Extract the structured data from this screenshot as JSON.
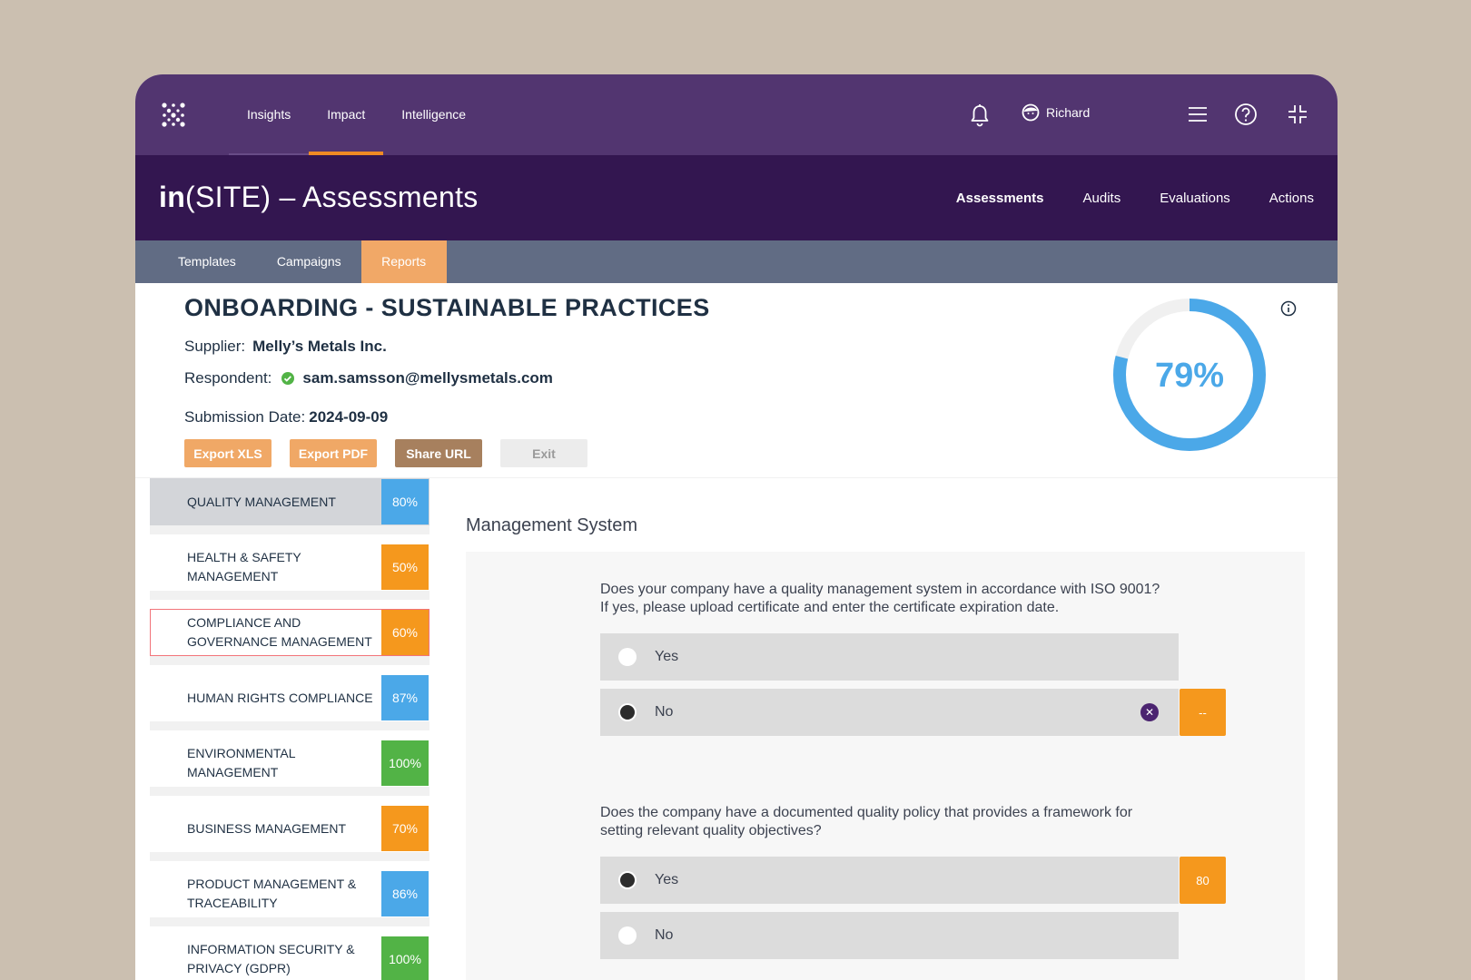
{
  "colors": {
    "top_nav": "#523570",
    "app_header": "#331650",
    "sub_tabs": "#616c84",
    "accent_orange": "#f08a24",
    "blue": "#4ba8e8",
    "orange": "#f5981d",
    "green": "#52b346"
  },
  "global_nav": {
    "links": [
      "Insights",
      "Impact",
      "Intelligence"
    ],
    "active": "Impact",
    "user_name": "Richard",
    "icons": [
      "logo-icon",
      "bell-icon",
      "user-avatar-icon",
      "hamburger-menu-icon",
      "help-icon",
      "collapse-icon"
    ]
  },
  "app": {
    "title_bold": "in",
    "title_rest": "(SITE) – Assessments",
    "nav": [
      "Assessments",
      "Audits",
      "Evaluations",
      "Actions"
    ],
    "active_nav": "Assessments"
  },
  "sub_tabs": [
    "Templates",
    "Campaigns",
    "Reports"
  ],
  "active_sub_tab": "Reports",
  "report": {
    "title": "ONBOARDING - SUSTAINABLE PRACTICES",
    "supplier_label": "Supplier:",
    "supplier": "Melly’s Metals Inc.",
    "respondent_label": "Respondent:",
    "respondent": "sam.samsson@mellysmetals.com",
    "submission_label": "Submission Date:",
    "submission_date": "2024-09-09",
    "buttons": [
      "Export XLS",
      "Export PDF",
      "Share URL",
      "Exit"
    ],
    "overall_score": "79%",
    "overall_fraction": 0.79
  },
  "categories": [
    {
      "label": "QUALITY MANAGEMENT",
      "pct": "80%",
      "color": "#4ba8e8",
      "selected": true
    },
    {
      "label": "HEALTH & SAFETY MANAGEMENT",
      "pct": "50%",
      "color": "#f5981d"
    },
    {
      "label": "COMPLIANCE AND GOVERNANCE MANAGEMENT",
      "pct": "60%",
      "color": "#f5981d",
      "outlined": true
    },
    {
      "label": "HUMAN RIGHTS COMPLIANCE",
      "pct": "87%",
      "color": "#4ba8e8"
    },
    {
      "label": "ENVIRONMENTAL MANAGEMENT",
      "pct": "100%",
      "color": "#52b346"
    },
    {
      "label": "BUSINESS MANAGEMENT",
      "pct": "70%",
      "color": "#f5981d"
    },
    {
      "label": "PRODUCT MANAGEMENT & TRACEABILITY",
      "pct": "86%",
      "color": "#4ba8e8"
    },
    {
      "label": "INFORMATION SECURITY & PRIVACY (GDPR)",
      "pct": "100%",
      "color": "#52b346"
    }
  ],
  "section": {
    "title": "Management System",
    "questions": [
      {
        "text": "Does your company have a quality management system in accordance with ISO 9001? If yes, please upload certificate and enter the certificate expiration date.",
        "options": [
          "Yes",
          "No"
        ],
        "selected": "No",
        "score": "--"
      },
      {
        "text": "Does the company have a documented quality policy that provides a framework for setting relevant quality objectives?",
        "options": [
          "Yes",
          "No"
        ],
        "selected": "Yes",
        "score": "80"
      }
    ]
  }
}
